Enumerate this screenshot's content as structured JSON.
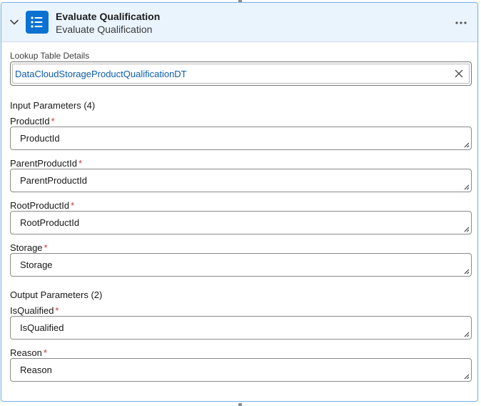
{
  "header": {
    "title": "Evaluate Qualification",
    "subtitle": "Evaluate Qualification",
    "accent_color": "#0b72d1",
    "icon": "list-icon"
  },
  "lookup": {
    "label": "Lookup Table Details",
    "value": "DataCloudStorageProductQualificationDT"
  },
  "input_parameters": {
    "heading": "Input Parameters (4)",
    "fields": [
      {
        "label": "ProductId",
        "required_mark": "*",
        "value": "ProductId"
      },
      {
        "label": "ParentProductId",
        "required_mark": "*",
        "value": "ParentProductId"
      },
      {
        "label": "RootProductId",
        "required_mark": "*",
        "value": "RootProductId"
      },
      {
        "label": "Storage",
        "required_mark": "*",
        "value": "Storage"
      }
    ]
  },
  "output_parameters": {
    "heading": "Output Parameters (2)",
    "fields": [
      {
        "label": "IsQualified",
        "required_mark": "*",
        "value": "IsQualified"
      },
      {
        "label": "Reason",
        "required_mark": "*",
        "value": "Reason"
      }
    ]
  }
}
